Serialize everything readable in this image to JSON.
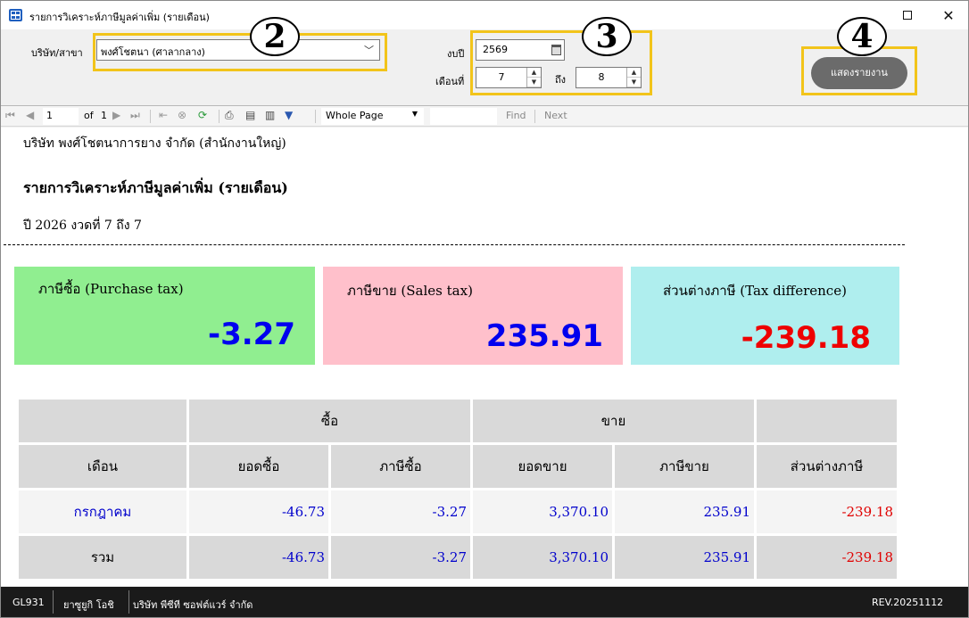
{
  "window": {
    "title": "รายการวิเคราะห์ภาษีมูลค่าเพิ่ม (รายเดือน)"
  },
  "params": {
    "company_label": "บริษัท/สาขา",
    "company_value": "พงศ์โชตนา (ศาลากลาง)",
    "year_label": "งบปี",
    "year_value": "2569",
    "month_label": "เดือนที่",
    "month_from": "7",
    "to_label": "ถึง",
    "month_to": "8",
    "report_button": "แสดงรายงาน"
  },
  "badges": {
    "company": "2",
    "period": "3",
    "report": "4"
  },
  "toolbar": {
    "page_current": "1",
    "page_of": "of",
    "page_total": "1",
    "zoom": "Whole Page",
    "find": "Find",
    "next": "Next"
  },
  "report": {
    "company": "บริษัท พงศ์โชตนาการยาง จำกัด (สำนักงานใหญ่)",
    "title": "รายการวิเคราะห์ภาษีมูลค่าเพิ่ม (รายเดือน)",
    "period": "ปี 2026  งวดที่ 7 ถึง 7",
    "cards": {
      "purchase": {
        "label": "ภาษีซื้อ (Purchase tax)",
        "value": "-3.27",
        "bg": "#90ee90",
        "value_color": "#0000ee"
      },
      "sales": {
        "label": "ภาษีขาย (Sales tax)",
        "value": "235.91",
        "bg": "#ffc0cb",
        "value_color": "#0000ee"
      },
      "difference": {
        "label": "ส่วนต่างภาษี (Tax difference)",
        "value": "-239.18",
        "bg": "#afeeee",
        "value_color": "#ee0000"
      }
    },
    "table": {
      "group_buy": "ซื้อ",
      "group_sell": "ขาย",
      "headers": [
        "เดือน",
        "ยอดซื้อ",
        "ภาษีซื้อ",
        "ยอดขาย",
        "ภาษีขาย",
        "ส่วนต่างภาษี"
      ],
      "rows": [
        {
          "month": "กรกฎาคม",
          "purchase_amount": "-46.73",
          "purchase_tax": "-3.27",
          "sales_amount": "3,370.10",
          "sales_tax": "235.91",
          "difference": "-239.18"
        }
      ],
      "total": {
        "label": "รวม",
        "purchase_amount": "-46.73",
        "purchase_tax": "-3.27",
        "sales_amount": "3,370.10",
        "sales_tax": "235.91",
        "difference": "-239.18"
      }
    }
  },
  "status": {
    "code": "GL931",
    "user": "ยาซูยูกิ  โอชิ",
    "company": "บริษัท พีซีที ซอฟต์แวร์ จำกัด",
    "revision": "REV.20251112"
  },
  "colors": {
    "highlight": "#f2c41a",
    "report_button": "#6b6b6b",
    "status_bar": "#1a1a1a"
  }
}
